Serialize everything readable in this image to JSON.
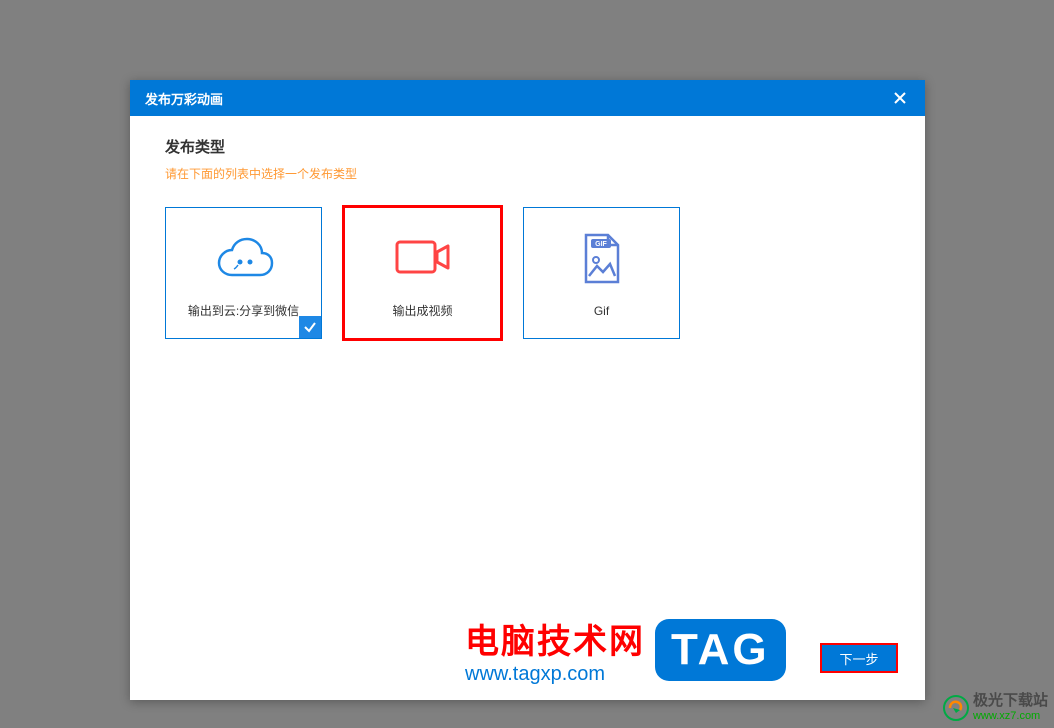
{
  "dialog": {
    "title": "发布万彩动画",
    "section_title": "发布类型",
    "section_hint": "请在下面的列表中选择一个发布类型"
  },
  "options": [
    {
      "label": "输出到云:分享到微信",
      "icon": "cloud-wechat-icon"
    },
    {
      "label": "输出成视频",
      "icon": "video-icon"
    },
    {
      "label": "Gif",
      "icon": "gif-icon"
    }
  ],
  "buttons": {
    "next": "下一步"
  },
  "watermark1": {
    "title": "电脑技术网",
    "url": "www.tagxp.com",
    "tag": "TAG"
  },
  "watermark2": {
    "title": "极光下载站",
    "url": "www.xz7.com"
  }
}
